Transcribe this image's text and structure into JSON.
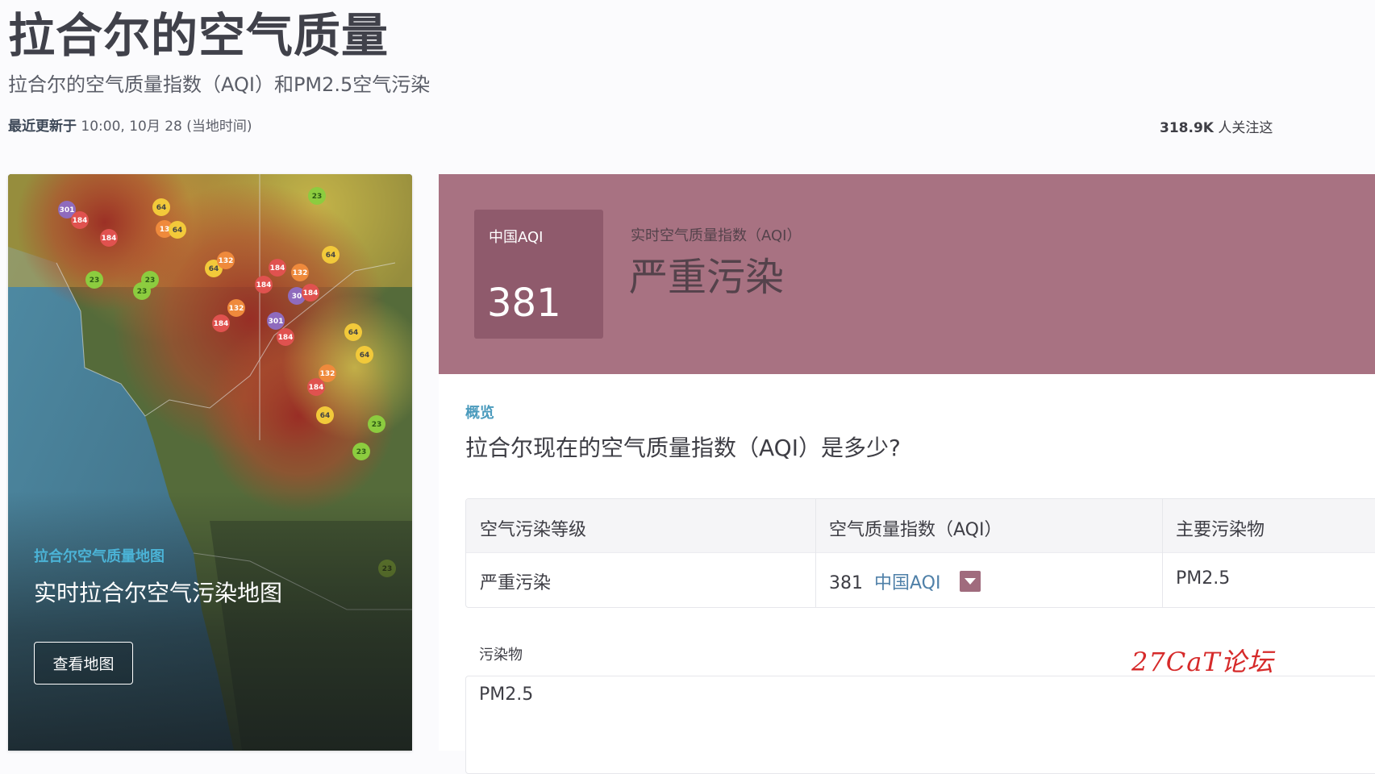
{
  "page": {
    "title": "拉合尔的空气质量",
    "subtitle": "拉合尔的空气质量指数（AQI）和PM2.5空气污染",
    "updated_label": "最近更新于",
    "updated_time": "10:00, 10月 28 (当地时间)",
    "followers_count": "318.9K",
    "followers_text": "人关注这"
  },
  "map_card": {
    "caption": "拉合尔空气质量地图",
    "heading": "实时拉合尔空气污染地图",
    "button_label": "查看地图",
    "markers": [
      "301",
      "184",
      "184",
      "64",
      "13",
      "64",
      "23",
      "23",
      "23",
      "64",
      "132",
      "64",
      "184",
      "132",
      "184",
      "30",
      "184",
      "132",
      "184",
      "301",
      "184",
      "64",
      "64",
      "132",
      "184",
      "64",
      "23",
      "23",
      "23",
      "23"
    ]
  },
  "aqi": {
    "box_label": "中国AQI",
    "value": "381",
    "realtime_label": "实时空气质量指数（AQI）",
    "level": "严重污染",
    "header_color": "#a87282",
    "box_color": "#8f5a6c"
  },
  "overview": {
    "label": "概览",
    "question": "拉合尔现在的空气质量指数（AQI）是多少?"
  },
  "table": {
    "headers": [
      "空气污染等级",
      "空气质量指数（AQI）",
      "主要污染物"
    ],
    "row": {
      "level": "严重污染",
      "aqi_value": "381",
      "aqi_unit": "中国AQI",
      "pollutant": "PM2.5"
    }
  },
  "pollutants": {
    "label": "污染物",
    "first_item": "PM2.5"
  },
  "watermark": "27CaT论坛"
}
